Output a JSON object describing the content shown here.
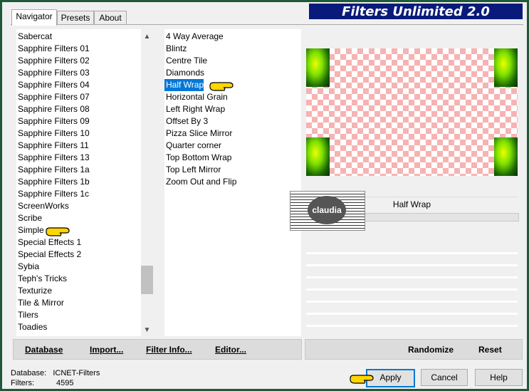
{
  "title": "Filters Unlimited 2.0",
  "tabs": [
    "Navigator",
    "Presets",
    "About"
  ],
  "categories": [
    "Sabercat",
    "Sapphire Filters 01",
    "Sapphire Filters 02",
    "Sapphire Filters 03",
    "Sapphire Filters 04",
    "Sapphire Filters 07",
    "Sapphire Filters 08",
    "Sapphire Filters 09",
    "Sapphire Filters 10",
    "Sapphire Filters 11",
    "Sapphire Filters 13",
    "Sapphire Filters 1a",
    "Sapphire Filters 1b",
    "Sapphire Filters 1c",
    "ScreenWorks",
    "Scribe",
    "Simple",
    "Special Effects 1",
    "Special Effects 2",
    "Sybia",
    "Teph's Tricks",
    "Texturize",
    "Tile & Mirror",
    "Tilers",
    "Toadies"
  ],
  "filters": [
    "4 Way Average",
    "Blintz",
    "Centre Tile",
    "Diamonds",
    "Half Wrap",
    "Horizontal Grain",
    "Left Right Wrap",
    "Offset By 3",
    "Pizza Slice Mirror",
    "Quarter corner",
    "Top Bottom Wrap",
    "Top Left Mirror",
    "Zoom Out and Flip"
  ],
  "selected_filter": "Half Wrap",
  "filter_name_label": "Half Wrap",
  "watermark": "claudia",
  "buttons": {
    "database": "Database",
    "import": "Import...",
    "filter_info": "Filter Info...",
    "editor": "Editor...",
    "randomize": "Randomize",
    "reset": "Reset",
    "apply": "Apply",
    "cancel": "Cancel",
    "help": "Help"
  },
  "status": {
    "database_label": "Database:",
    "database_value": "ICNET-Filters",
    "filters_label": "Filters:",
    "filters_value": "4595"
  }
}
